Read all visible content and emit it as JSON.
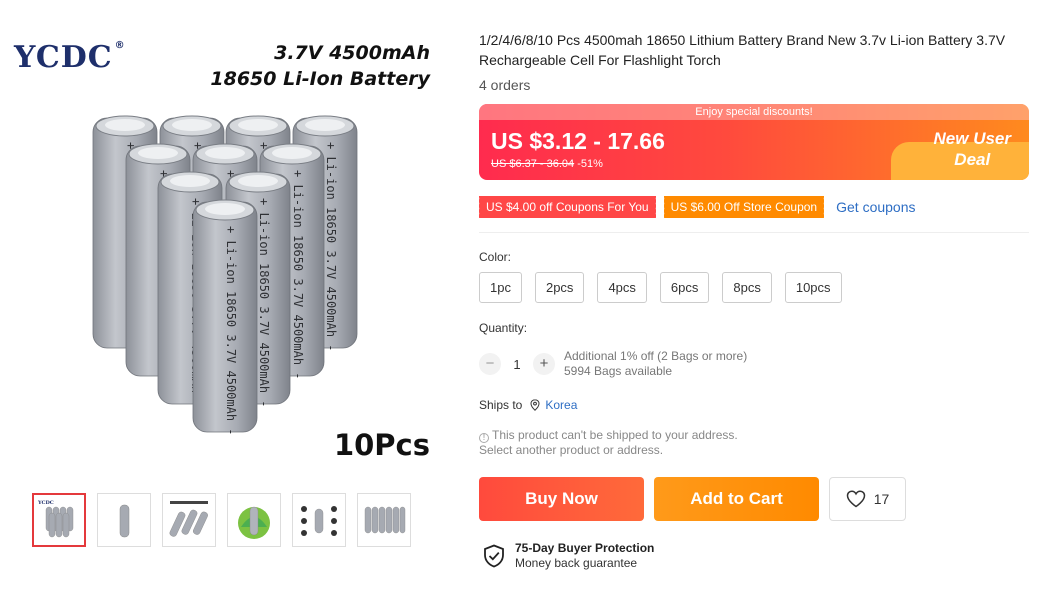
{
  "gallery": {
    "brand": "YCDC",
    "brand_mark": "®",
    "headline_line1": "3.7V 4500mAh",
    "headline_line2": "18650 Li-Ion Battery",
    "count_label": "10Pcs",
    "battery_print": "+ Li-ion 18650 3.7V 4500mAh -",
    "thumbnails": [
      "thumb-main",
      "thumb-single",
      "thumb-performance",
      "thumb-eco",
      "thumb-features",
      "thumb-row"
    ]
  },
  "product": {
    "title": "1/2/4/6/8/10 Pcs 4500mah 18650 Lithium Battery Brand New 3.7v Li-ion Battery 3.7V Rechargeable Cell For Flashlight Torch",
    "orders": "4 orders"
  },
  "price": {
    "promo": "Enjoy special discounts!",
    "range": "US $3.12 - 17.66",
    "original": "US $6.37 - 36.04",
    "discount": "-51%",
    "badge_line1": "New User",
    "badge_line2": "Deal"
  },
  "coupons": {
    "c1": "US $4.00 off Coupons For You",
    "c2": "US $6.00 Off Store Coupon",
    "link": "Get coupons"
  },
  "color": {
    "label": "Color:",
    "options": [
      "1pc",
      "2pcs",
      "4pcs",
      "6pcs",
      "8pcs",
      "10pcs"
    ]
  },
  "quantity": {
    "label": "Quantity:",
    "minus": "−",
    "value": "1",
    "plus": "+",
    "note_line1": "Additional 1% off (2 Bags or more)",
    "note_line2": "5994 Bags available"
  },
  "shipping": {
    "label": "Ships to",
    "country": "Korea",
    "warn_line1": "This product can't be shipped to your address.",
    "warn_line2": "Select another product or address."
  },
  "actions": {
    "buy_now": "Buy Now",
    "add_to_cart": "Add to Cart",
    "wishlist_count": "17"
  },
  "protection": {
    "title": "75-Day Buyer Protection",
    "subtitle": "Money back guarantee"
  },
  "colors": {
    "accent_red": "#ff4747",
    "accent_orange": "#ff8a00",
    "link_blue": "#2e6ec4",
    "battery_gray": "#a6aab2"
  }
}
